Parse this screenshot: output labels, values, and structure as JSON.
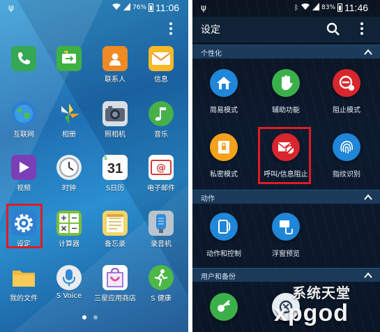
{
  "left_screen": {
    "status": {
      "battery": "76%",
      "time": "11:06"
    },
    "apps": [
      {
        "label": "",
        "icon": "phone-icon",
        "color": "#34a853"
      },
      {
        "label": "",
        "icon": "message-transfer-icon",
        "color": "#3fb143"
      },
      {
        "label": "联系人",
        "icon": "contacts-icon",
        "color": "#f08a24"
      },
      {
        "label": "信息",
        "icon": "envelope-icon",
        "color": "#f7b928"
      },
      {
        "label": "互联网",
        "icon": "globe-icon",
        "color": "#2f7fd1"
      },
      {
        "label": "相册",
        "icon": "gallery-icon",
        "color": "#f2c230"
      },
      {
        "label": "照相机",
        "icon": "camera-icon",
        "color": "#7b8794"
      },
      {
        "label": "音乐",
        "icon": "music-icon",
        "color": "#46b04a"
      },
      {
        "label": "视频",
        "icon": "video-icon",
        "color": "#7a3fb6"
      },
      {
        "label": "时钟",
        "icon": "clock-icon",
        "color": "#e9ecef"
      },
      {
        "label": "S日历",
        "icon": "calendar-icon",
        "color": "#ffffff"
      },
      {
        "label": "电子邮件",
        "icon": "email-icon",
        "color": "#ffffff"
      },
      {
        "label": "设定",
        "icon": "gear-icon",
        "color": "#2f7fd1"
      },
      {
        "label": "计算器",
        "icon": "calculator-icon",
        "color": "#7ebd3b"
      },
      {
        "label": "备忘录",
        "icon": "memo-icon",
        "color": "#f2d56b"
      },
      {
        "label": "录音机",
        "icon": "recorder-icon",
        "color": "#b9c4cf"
      },
      {
        "label": "我的文件",
        "icon": "folder-icon",
        "color": "#f4b73b"
      },
      {
        "label": "S Voice",
        "icon": "microphone-icon",
        "color": "#e9ecef"
      },
      {
        "label": "三星应用商店",
        "icon": "store-bag-icon",
        "color": "#ffffff"
      },
      {
        "label": "S 健康",
        "icon": "runner-icon",
        "color": "#4cb847"
      }
    ],
    "calendar_day": "31",
    "calendar_badge": "S"
  },
  "right_screen": {
    "status": {
      "battery": "83%",
      "time": "11:46"
    },
    "title": "设定",
    "sections": [
      {
        "title": "个性化"
      },
      {
        "title": "动作"
      },
      {
        "title": "用户和备份"
      }
    ],
    "settings": [
      {
        "label": "简易模式",
        "icon": "easy-mode-icon",
        "color": "#1f86d8"
      },
      {
        "label": "辅助功能",
        "icon": "accessibility-hand-icon",
        "color": "#3bb04a"
      },
      {
        "label": "阻止模式",
        "icon": "blocking-mode-icon",
        "color": "#d7262d"
      },
      {
        "label": "私密模式",
        "icon": "private-mode-icon",
        "color": "#f2a21b"
      },
      {
        "label": "呼叫/信息阻止",
        "icon": "call-block-icon",
        "color": "#d7262d"
      },
      {
        "label": "指纹识别",
        "icon": "fingerprint-icon",
        "color": "#1f86d8"
      },
      {
        "label": "动作和控制",
        "icon": "motion-icon",
        "color": "#1f86d8"
      },
      {
        "label": "浮窗预览",
        "icon": "air-view-icon",
        "color": "#1f86d8"
      },
      {
        "label": "",
        "icon": "key-icon",
        "color": "#3bb04a"
      },
      {
        "label": "",
        "icon": "backup-icon",
        "color": "#2b3f55"
      }
    ]
  },
  "watermark": {
    "cn": "系统天堂",
    "en": "xpgod"
  }
}
